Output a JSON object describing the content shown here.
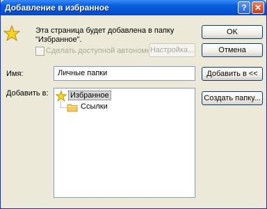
{
  "window": {
    "title": "Добавление в избранное",
    "help_label": "?",
    "close_label": "✕"
  },
  "message": {
    "line1": "Эта страница будет добавлена в папку",
    "line2": "\"Избранное\"."
  },
  "offline": {
    "label": "Сделать доступной автономно",
    "checked": false,
    "enabled": false,
    "setup_label": "Настройка..."
  },
  "buttons": {
    "ok": "OK",
    "cancel": "Отмена",
    "add_to": "Добавить в <<",
    "new_folder": "Создать папку..."
  },
  "form": {
    "name_label": "Имя:",
    "name_value": "Личные папки",
    "add_to_label": "Добавить в:"
  },
  "tree": {
    "root": "Избранное",
    "children": [
      "Ссылки"
    ],
    "selected": "Избранное"
  },
  "colors": {
    "title_bar": "#0654d8",
    "dialog_bg": "#ece9d8",
    "selection": "#d7d7d7",
    "folder": "#f5cc5a",
    "star": "#f7d21e"
  },
  "icons": {
    "message": "favorites-star-icon",
    "tree_root": "favorites-star-icon",
    "tree_child": "folder-icon"
  }
}
